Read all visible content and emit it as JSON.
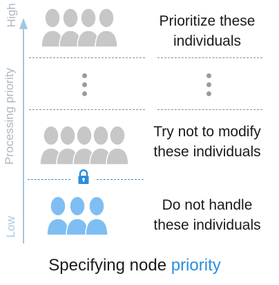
{
  "axis": {
    "high_label": "High",
    "low_label": "Low",
    "title": "Processing priority"
  },
  "tiers": [
    {
      "text_line1": "Prioritize these",
      "text_line2": "individuals",
      "people_count": 4,
      "people_color": "#c7c7c7"
    },
    {
      "text_line1": "Try not to modify",
      "text_line2": "these individuals",
      "people_count": 5,
      "people_color": "#c7c7c7"
    },
    {
      "text_line1": "Do not handle",
      "text_line2": "these individuals",
      "people_count": 3,
      "people_color": "#7fbef2"
    }
  ],
  "icons": {
    "lock": "lock-icon",
    "ellipsis": "vertical-ellipsis-icon",
    "person": "person-icon"
  },
  "colors": {
    "accent": "#2a8fde",
    "gray_people": "#c7c7c7",
    "blue_people": "#7fbef2",
    "axis": "#9fc6e3"
  },
  "caption": {
    "prefix": "Specifying node ",
    "accent_word": "priority"
  }
}
